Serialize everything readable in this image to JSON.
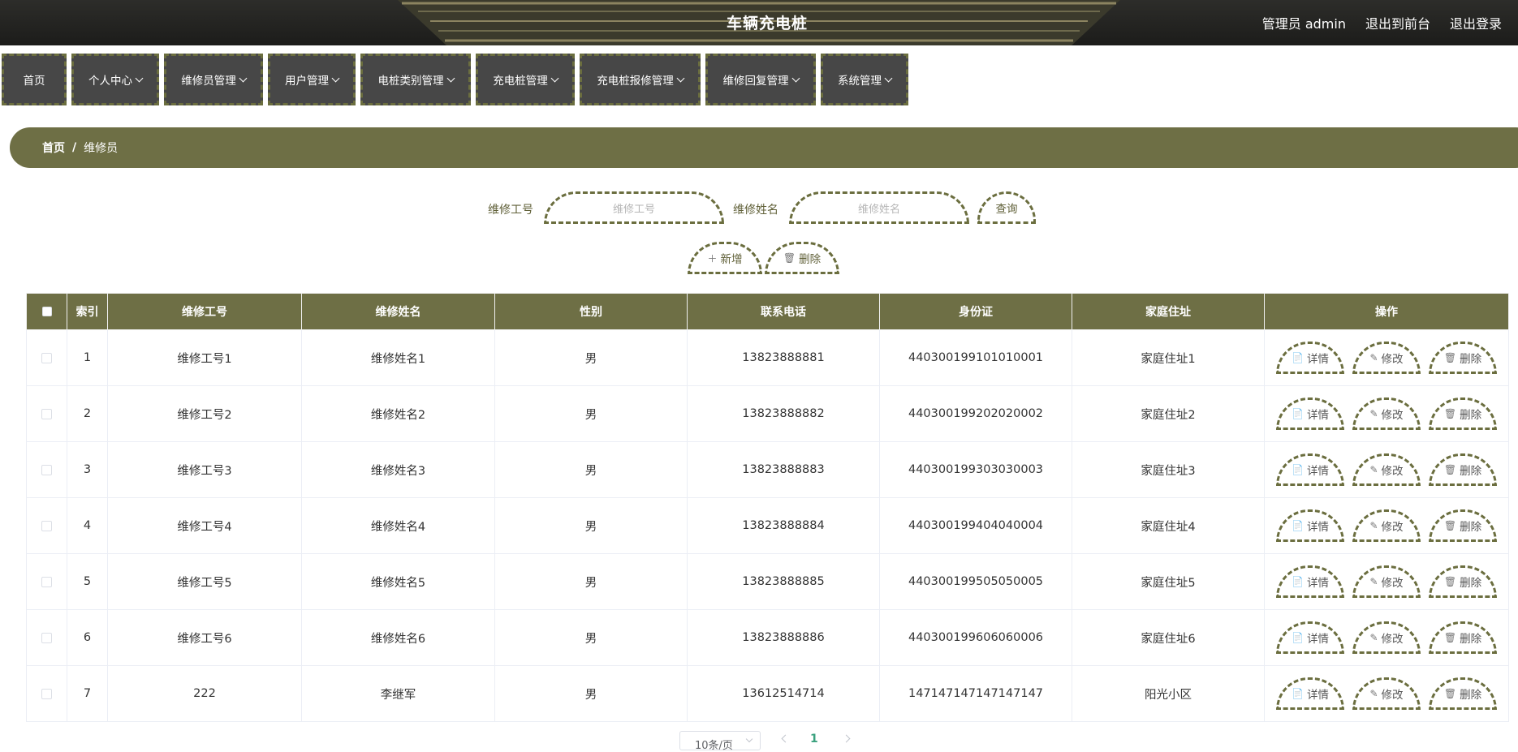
{
  "header": {
    "title": "车辆充电桩",
    "admin_label": "管理员 admin",
    "front_label": "退出到前台",
    "logout_label": "退出登录"
  },
  "nav": {
    "items": [
      {
        "label": "首页"
      },
      {
        "label": "个人中心"
      },
      {
        "label": "维修员管理"
      },
      {
        "label": "用户管理"
      },
      {
        "label": "电桩类别管理"
      },
      {
        "label": "充电桩管理"
      },
      {
        "label": "充电桩报修管理"
      },
      {
        "label": "维修回复管理"
      },
      {
        "label": "系统管理"
      }
    ]
  },
  "breadcrumb": {
    "home": "首页",
    "separator": "/",
    "current": "维修员"
  },
  "search": {
    "field1_label": "维修工号",
    "field1_placeholder": "维修工号",
    "field2_label": "维修姓名",
    "field2_placeholder": "维修姓名",
    "query_label": "查询",
    "add_label": "新增",
    "delete_label": "删除"
  },
  "table": {
    "headers": [
      "索引",
      "维修工号",
      "维修姓名",
      "性别",
      "联系电话",
      "身份证",
      "家庭住址",
      "操作"
    ],
    "rows": [
      {
        "index": "1",
        "worker_id": "维修工号1",
        "name": "维修姓名1",
        "gender": "男",
        "phone": "13823888881",
        "id_card": "440300199101010001",
        "address": "家庭住址1"
      },
      {
        "index": "2",
        "worker_id": "维修工号2",
        "name": "维修姓名2",
        "gender": "男",
        "phone": "13823888882",
        "id_card": "440300199202020002",
        "address": "家庭住址2"
      },
      {
        "index": "3",
        "worker_id": "维修工号3",
        "name": "维修姓名3",
        "gender": "男",
        "phone": "13823888883",
        "id_card": "440300199303030003",
        "address": "家庭住址3"
      },
      {
        "index": "4",
        "worker_id": "维修工号4",
        "name": "维修姓名4",
        "gender": "男",
        "phone": "13823888884",
        "id_card": "440300199404040004",
        "address": "家庭住址4"
      },
      {
        "index": "5",
        "worker_id": "维修工号5",
        "name": "维修姓名5",
        "gender": "男",
        "phone": "13823888885",
        "id_card": "440300199505050005",
        "address": "家庭住址5"
      },
      {
        "index": "6",
        "worker_id": "维修工号6",
        "name": "维修姓名6",
        "gender": "男",
        "phone": "13823888886",
        "id_card": "440300199606060006",
        "address": "家庭住址6"
      },
      {
        "index": "7",
        "worker_id": "222",
        "name": "李继军",
        "gender": "男",
        "phone": "13612514714",
        "id_card": "147147147147147147",
        "address": "阳光小区"
      }
    ],
    "actions": {
      "detail": "详情",
      "edit": "修改",
      "delete": "删除"
    }
  },
  "pagination": {
    "page_size": "10条/页",
    "current_page": "1"
  },
  "colors": {
    "accent": "#6e6f45",
    "nav_bg": "#474747",
    "header_bg": "#1c1c1a",
    "active_page": "#3aa17e"
  }
}
